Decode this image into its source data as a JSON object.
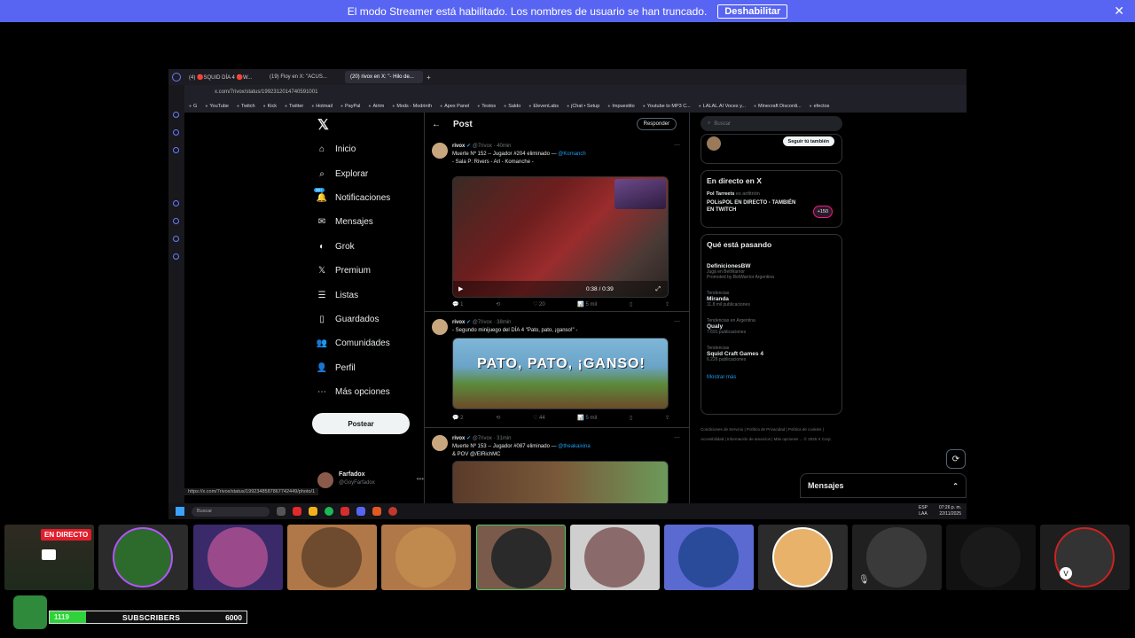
{
  "banner": {
    "text": "El modo Streamer está habilitado. Los nombres de usuario se han truncado.",
    "button": "Deshabilitar",
    "close": "✕"
  },
  "browser": {
    "tabs": [
      "(4) 🔴SQUID DÍA 4 🔴W...",
      "(19) Floy en X: \"ACUS...",
      "(20) rivox en X: \"- Hilo de..."
    ],
    "url": "x.com/7rivox/status/1992312014740591001",
    "bookmarks": [
      "G",
      "YouTube",
      "Twitch",
      "Kick",
      "Twitter",
      "Hotmail",
      "PayPal",
      "Airtm",
      "Mods - Modrinth",
      "Apex Panel",
      "Textos",
      "Saldo",
      "ElevenLabs",
      "jChat • Setup",
      "Impuestito",
      "Youtube to MP3 C...",
      "LALAL.AI Voces y...",
      "Minecraft Discordi...",
      "efectos"
    ],
    "status_url": "https://x.com/7rivox/status/1992348587867742449/photo/1"
  },
  "x": {
    "logo": "𝕏",
    "nav": [
      {
        "label": "Inicio",
        "icon": "⌂"
      },
      {
        "label": "Explorar",
        "icon": "⌕"
      },
      {
        "label": "Notificaciones",
        "icon": "🔔",
        "badge": "20+"
      },
      {
        "label": "Mensajes",
        "icon": "✉"
      },
      {
        "label": "Grok",
        "icon": "◐"
      },
      {
        "label": "Premium",
        "icon": "𝕏"
      },
      {
        "label": "Listas",
        "icon": "☰"
      },
      {
        "label": "Guardados",
        "icon": "▯"
      },
      {
        "label": "Comunidades",
        "icon": "👥"
      },
      {
        "label": "Perfil",
        "icon": "👤"
      },
      {
        "label": "Más opciones",
        "icon": "⋯"
      }
    ],
    "post_button": "Postear",
    "profile": {
      "name": "Farfadox",
      "handle": "@GoyFarfadox"
    },
    "feed_title": "Post",
    "reply_button": "Responder",
    "tweets": [
      {
        "name": "rivox",
        "handle": "@7rivox · 40min",
        "text1": "Muerte Nº 152 -- Jugador #204 eliminado —",
        "mention1": "@Komanch",
        "text2": "- Sala P: Rivers - Arl - Komanche -",
        "time": "0:38 / 0:39",
        "actions": [
          "1",
          "",
          "20",
          "5 mil",
          "",
          ""
        ]
      },
      {
        "name": "rivox",
        "handle": "@7rivox · 38min",
        "text1": "- Segundo minijuego del DÍA 4 \"Pato, pato, ¡ganso!\" -",
        "media_text": "PATO, PATO, ¡GANSO!",
        "actions": [
          "2",
          "",
          "44",
          "5 mil",
          "",
          ""
        ]
      },
      {
        "name": "rivox",
        "handle": "@7rivox · 31min",
        "text1": "Muerte Nº 153 -- Jugador #087 eliminado —",
        "mention1": "@theakaixina",
        "text2": "& POV @/ElRichMC"
      }
    ],
    "search_placeholder": "Buscar",
    "follow_button": "Seguir tú también",
    "live": {
      "title": "En directo en X",
      "host": "Pol Tarreets",
      "host_note": "es anfitrión",
      "stream": "POLisPOL EN DIRECTO - TAMBIÉN EN TWITCH",
      "viewers": "+150"
    },
    "trends": {
      "title": "Qué está pasando",
      "items": [
        {
          "name": "DefinicionesBW",
          "small1": "Jugá en BetWarrior",
          "small2": "Promoted by BetWarrior Argentina"
        },
        {
          "small1": "Tendencias",
          "name": "Miranda",
          "small2": "11,8 mil publicaciones"
        },
        {
          "small1": "Tendencias en Argentina",
          "name": "Qualy",
          "small2": "7.691 publicaciones"
        },
        {
          "small1": "Tendencias",
          "name": "Squid Craft Games 4",
          "small2": "6.226 publicaciones"
        }
      ],
      "more": "Mostrar más"
    },
    "footer": "Condiciones de Servicio | Política de Privacidad | Política de cookies | Accesibilidad | Información de anuncios | Más opciones ... © 2025 X Corp.",
    "messages": "Mensajes"
  },
  "taskbar": {
    "search": "Buscar",
    "lang1": "ESP",
    "lang2": "LAA",
    "time": "07:26 p. m.",
    "date": "22/11/2025"
  },
  "live_badge": "EN DIRECTO",
  "subscribers": {
    "current": "1119",
    "label": "SUBSCRIBERS",
    "goal": "6000",
    "progress": 0.186
  },
  "colors": {
    "banner": "#5865f2",
    "accent": "#1d9bf0",
    "live": "#e21d2c",
    "sub_fill": "#2fd23a"
  }
}
